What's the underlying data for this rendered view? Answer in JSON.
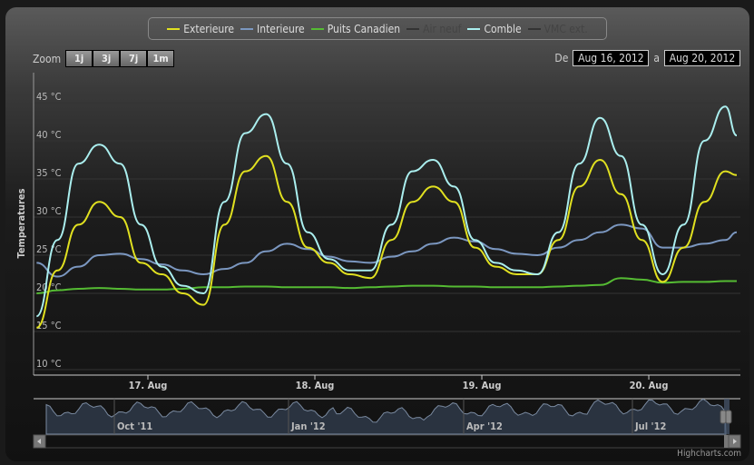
{
  "legend": [
    {
      "label": "Exterieure",
      "color": "#e0e020",
      "visible": true
    },
    {
      "label": "Interieure",
      "color": "#7b97c0",
      "visible": true
    },
    {
      "label": "Puits Canadien",
      "color": "#55bb33",
      "visible": true
    },
    {
      "label": "Air neuf",
      "color": "#333333",
      "visible": false
    },
    {
      "label": "Comble",
      "color": "#aaeeee",
      "visible": true
    },
    {
      "label": "VMC ext.",
      "color": "#333333",
      "visible": false
    }
  ],
  "zoom": {
    "label": "Zoom",
    "buttons": [
      "1j",
      "3j",
      "7j",
      "1m"
    ]
  },
  "range": {
    "from_label": "De",
    "from": "Aug 16, 2012",
    "to_label": "a",
    "to": "Aug 20, 2012"
  },
  "credits": "Highcharts.com",
  "chart_data": {
    "type": "line",
    "ylabel": "Temperatures",
    "y_ticks": [
      "10 °C",
      "15 °C",
      "20 °C",
      "25 °C",
      "30 °C",
      "35 °C",
      "40 °C",
      "45 °C"
    ],
    "y_tick_values": [
      10,
      15,
      20,
      25,
      30,
      35,
      40,
      45
    ],
    "ylim": [
      10,
      47
    ],
    "x_unit": "hours since Aug 16 2012 00:00",
    "xlim": [
      8,
      110
    ],
    "x_ticks": [
      {
        "label": "17. Aug",
        "value": 24
      },
      {
        "label": "18. Aug",
        "value": 48
      },
      {
        "label": "19. Aug",
        "value": 72
      },
      {
        "label": "20. Aug",
        "value": 96
      }
    ],
    "x": [
      8,
      11,
      14,
      17,
      20,
      23,
      26,
      29,
      32,
      35,
      38,
      41,
      44,
      47,
      50,
      53,
      56,
      59,
      62,
      65,
      68,
      71,
      74,
      77,
      80,
      83,
      86,
      89,
      92,
      95,
      98,
      101,
      104,
      107,
      110
    ],
    "series": [
      {
        "name": "Exterieure",
        "values": [
          15.5,
          23,
          29,
          32,
          30,
          24,
          22.5,
          20,
          18.5,
          29,
          36,
          38,
          32,
          26,
          24,
          22.5,
          22,
          27,
          32,
          34,
          32,
          26,
          23.5,
          22.5,
          22.5,
          27,
          34,
          37.5,
          33,
          27,
          21.5,
          26,
          32,
          36,
          35.5
        ]
      },
      {
        "name": "Interieure",
        "values": [
          24,
          22.2,
          23.5,
          25,
          25.2,
          24.5,
          23.8,
          23,
          22.5,
          23.2,
          24,
          25.5,
          26.5,
          25.8,
          24.8,
          24.2,
          24,
          24.8,
          25.5,
          26.5,
          27.3,
          26.8,
          25.8,
          25.2,
          25,
          26,
          27,
          28,
          29,
          28.5,
          26,
          26,
          26.5,
          27,
          28
        ]
      },
      {
        "name": "Puits Canadien",
        "values": [
          20,
          20.4,
          20.6,
          20.7,
          20.6,
          20.5,
          20.5,
          20.6,
          20.8,
          20.8,
          20.9,
          20.9,
          20.8,
          20.8,
          20.8,
          20.7,
          20.8,
          20.9,
          21,
          21,
          20.9,
          20.9,
          20.8,
          20.8,
          20.8,
          20.9,
          21,
          21.1,
          22,
          21.8,
          21.4,
          21.5,
          21.5,
          21.6,
          21.6
        ]
      },
      {
        "name": "Comble",
        "values": [
          17,
          27,
          37,
          39.5,
          37,
          29,
          23.5,
          21,
          20,
          32,
          41,
          43.5,
          37,
          28,
          24.5,
          23,
          23,
          29,
          36,
          37.5,
          34,
          27,
          24,
          23,
          22.5,
          28,
          37,
          43,
          38,
          29,
          22.5,
          29,
          40,
          44.5,
          40.7
        ]
      }
    ],
    "navigator": {
      "x_ticks": [
        "Oct '11",
        "Jan '12",
        "Apr '12",
        "Jul '12"
      ]
    }
  }
}
